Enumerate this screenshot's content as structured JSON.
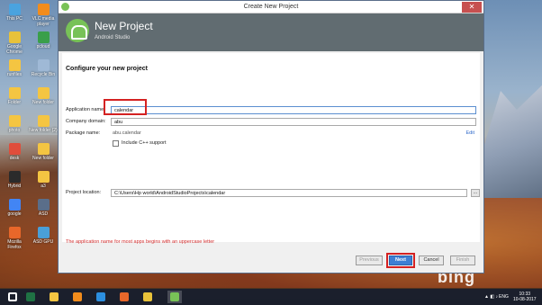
{
  "desktop": {
    "icons": [
      {
        "label": "This PC",
        "color": "#4aa3df"
      },
      {
        "label": "VLC media player",
        "color": "#f28c1c"
      },
      {
        "label": "Google Chrome",
        "color": "#e8c23a"
      },
      {
        "label": "pcloud",
        "color": "#3a9f4a"
      },
      {
        "label": "runfiles",
        "color": "#f4c542"
      },
      {
        "label": "Recycle Bin",
        "color": "#9fb9d6"
      },
      {
        "label": "Folder",
        "color": "#f4c542"
      },
      {
        "label": "New folder",
        "color": "#f4c542"
      },
      {
        "label": "photo",
        "color": "#f4c542"
      },
      {
        "label": "New folder (2)",
        "color": "#f4c542"
      },
      {
        "label": "desk",
        "color": "#e04d3b"
      },
      {
        "label": "New folder",
        "color": "#f4c542"
      },
      {
        "label": "Hybrid",
        "color": "#2b2b2b"
      },
      {
        "label": "a3",
        "color": "#f4c542"
      },
      {
        "label": "google",
        "color": "#4285f4"
      },
      {
        "label": "ASD",
        "color": "#5a6e8a"
      },
      {
        "label": "Mozilla Firefox",
        "color": "#e8672a"
      },
      {
        "label": "ASD GPU",
        "color": "#4a9fd8"
      }
    ],
    "brand_text": "bing"
  },
  "dialog": {
    "title": "Create New Project",
    "header": {
      "title": "New Project",
      "subtitle": "Android Studio"
    },
    "section_title": "Configure your new project",
    "application_name": {
      "label": "Application name:",
      "value": "calendar"
    },
    "company_domain": {
      "label": "Company domain:",
      "value": "abu"
    },
    "package_name": {
      "label": "Package name:",
      "value": "abu.calendar",
      "edit_label": "Edit"
    },
    "cpp_support": {
      "label": "Include C++ support",
      "checked": false
    },
    "project_location": {
      "label": "Project location:",
      "value": "C:\\Users\\Hp world\\AndroidStudioProjects\\calendar",
      "browse_label": "..."
    },
    "hint": "The application name for most apps begins with an uppercase letter",
    "buttons": {
      "previous": "Previous",
      "next": "Next",
      "cancel": "Cancel",
      "finish": "Finish"
    }
  },
  "taskbar": {
    "apps": [
      {
        "name": "start",
        "color": "#ffffff"
      },
      {
        "name": "excel",
        "color": "#1f7244"
      },
      {
        "name": "explorer",
        "color": "#f4c542"
      },
      {
        "name": "vlc",
        "color": "#f28c1c"
      },
      {
        "name": "ie",
        "color": "#2c8fe0"
      },
      {
        "name": "firefox",
        "color": "#e8672a"
      },
      {
        "name": "chrome",
        "color": "#e8c23a"
      },
      {
        "name": "android-studio",
        "color": "#78c257"
      }
    ],
    "language": "ENG",
    "time": "10:33",
    "date": "10-08-2017"
  }
}
